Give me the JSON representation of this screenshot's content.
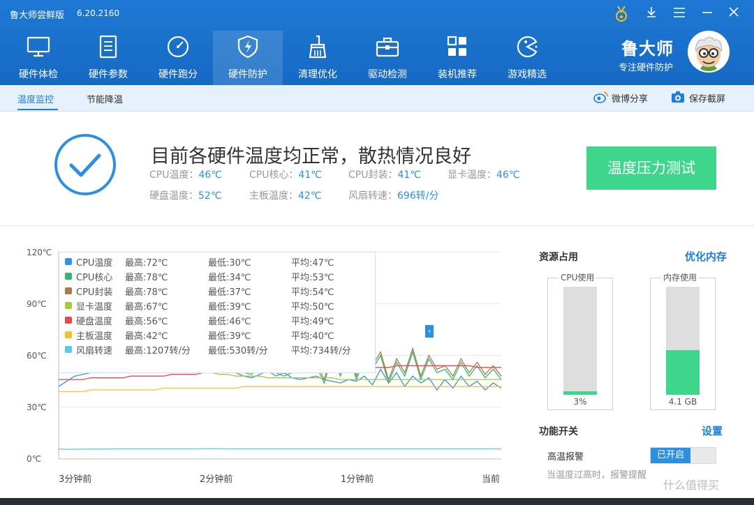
{
  "window": {
    "title": "鲁大师尝鲜版",
    "version": "6.20.2160",
    "controls": [
      "medal-icon",
      "download-icon",
      "menu-icon",
      "minimize-icon",
      "close-icon"
    ]
  },
  "nav": [
    {
      "label": "硬件体检",
      "icon": "monitor-icon"
    },
    {
      "label": "硬件参数",
      "icon": "document-icon"
    },
    {
      "label": "硬件跑分",
      "icon": "speedometer-icon"
    },
    {
      "label": "硬件防护",
      "icon": "shield-icon",
      "active": true
    },
    {
      "label": "清理优化",
      "icon": "broom-icon"
    },
    {
      "label": "驱动检测",
      "icon": "toolbox-icon"
    },
    {
      "label": "装机推荐",
      "icon": "grid-icon"
    },
    {
      "label": "游戏精选",
      "icon": "game-icon"
    }
  ],
  "brand": {
    "name": "鲁大师",
    "slogan": "专注硬件防护"
  },
  "subtabs": [
    {
      "label": "温度监控",
      "active": true
    },
    {
      "label": "节能降温"
    }
  ],
  "subactions": [
    {
      "label": "微博分享",
      "icon": "weibo-icon"
    },
    {
      "label": "保存截屏",
      "icon": "camera-icon"
    }
  ],
  "status": {
    "title": "目前各硬件温度均正常，散热情况良好",
    "readings": [
      {
        "label": "CPU温度：",
        "value": "46℃"
      },
      {
        "label": "CPU核心：",
        "value": "41℃"
      },
      {
        "label": "CPU封装：",
        "value": "41℃"
      },
      {
        "label": "显卡温度：",
        "value": "46℃"
      },
      {
        "label": "硬盘温度：",
        "value": "52℃"
      },
      {
        "label": "主板温度：",
        "value": "42℃"
      },
      {
        "label": "风扇转速：",
        "value": "696转/分"
      }
    ],
    "button": "温度压力测试"
  },
  "chart_data": {
    "type": "line",
    "y_ticks": [
      "120℃",
      "90℃",
      "60℃",
      "30℃",
      "0℃"
    ],
    "ylim": [
      0,
      120
    ],
    "x_ticks": [
      "3分钟前",
      "2分钟前",
      "1分钟前",
      "当前"
    ],
    "legend_placement": "top-left",
    "series": [
      {
        "name": "CPU温度",
        "color": "#3a8ee6",
        "max": "最高:72℃",
        "min": "最低:30℃",
        "avg": "平均:47℃",
        "values": [
          42,
          45,
          48,
          49,
          50,
          50,
          51,
          50,
          52,
          51,
          50,
          52,
          51,
          52,
          51,
          52,
          52,
          51,
          58,
          55,
          52,
          56,
          50,
          48,
          47,
          49,
          51,
          48,
          50,
          47,
          46,
          47,
          48,
          46,
          45,
          44,
          46,
          45,
          48,
          43,
          52,
          44,
          50,
          42,
          48,
          44,
          47,
          40,
          46,
          41,
          48,
          42,
          45,
          40,
          44,
          41
        ]
      },
      {
        "name": "CPU核心",
        "color": "#2fb96e",
        "max": "最高:78℃",
        "min": "最低:34℃",
        "avg": "平均:53℃",
        "values": [
          60,
          61,
          56,
          55,
          55,
          54,
          54,
          53,
          53,
          52,
          52,
          52,
          52,
          53,
          52,
          52,
          53,
          53,
          60,
          58,
          56,
          60,
          52,
          50,
          49,
          55,
          58,
          50,
          48,
          50,
          52,
          60,
          54,
          44,
          60,
          48,
          62,
          46,
          58,
          52,
          60,
          44,
          56,
          48,
          62,
          46,
          58,
          50,
          52,
          46,
          56,
          48,
          54,
          47,
          52,
          46
        ]
      },
      {
        "name": "CPU封装",
        "color": "#b07850",
        "max": "最高:78℃",
        "min": "最低:37℃",
        "avg": "平均:54℃",
        "values": [
          64,
          66,
          62,
          58,
          56,
          56,
          55,
          55,
          54,
          54,
          53,
          53,
          53,
          54,
          53,
          54,
          54,
          55,
          62,
          58,
          56,
          64,
          50,
          52,
          51,
          58,
          60,
          54,
          50,
          52,
          54,
          64,
          56,
          46,
          62,
          50,
          64,
          48,
          60,
          54,
          62,
          46,
          58,
          50,
          64,
          48,
          60,
          52,
          54,
          48,
          58,
          50,
          56,
          49,
          54,
          48
        ]
      },
      {
        "name": "显卡温度",
        "color": "#a8c83a",
        "max": "最高:67℃",
        "min": "最低:39℃",
        "avg": "平均:50℃",
        "values": [
          58,
          57,
          56,
          55,
          55,
          54,
          54,
          53,
          53,
          52,
          52,
          52,
          51,
          51,
          51,
          50,
          50,
          50,
          50,
          50,
          49,
          49,
          48,
          48,
          48,
          48,
          47,
          47,
          47,
          47,
          47,
          47,
          47,
          47,
          47,
          46,
          46,
          46,
          46,
          46,
          46,
          46,
          46,
          46,
          46,
          46,
          46,
          46,
          46,
          46,
          46,
          46,
          46,
          46,
          46,
          46
        ]
      },
      {
        "name": "硬盘温度",
        "color": "#e84a4a",
        "max": "最高:56℃",
        "min": "最低:46℃",
        "avg": "平均:49℃",
        "values": [
          46,
          46,
          46,
          46,
          47,
          47,
          47,
          47,
          47,
          48,
          48,
          48,
          48,
          48,
          49,
          49,
          49,
          49,
          50,
          50,
          50,
          50,
          50,
          51,
          51,
          51,
          51,
          51,
          51,
          52,
          52,
          52,
          52,
          52,
          52,
          52,
          53,
          53,
          53,
          53,
          53,
          53,
          54,
          54,
          54,
          54,
          54,
          54,
          54,
          54,
          54,
          54,
          53,
          53,
          53,
          53
        ]
      },
      {
        "name": "主板温度",
        "color": "#f0c030",
        "max": "最高:42℃",
        "min": "最低:39℃",
        "avg": "平均:40℃",
        "values": [
          39,
          39,
          39,
          39,
          40,
          40,
          40,
          40,
          40,
          40,
          40,
          40,
          40,
          41,
          41,
          41,
          41,
          41,
          41,
          41,
          41,
          41,
          41,
          42,
          42,
          42,
          42,
          42,
          42,
          42,
          42,
          42,
          42,
          42,
          42,
          42,
          42,
          42,
          42,
          42,
          42,
          42,
          42,
          42,
          42,
          42,
          42,
          42,
          42,
          42,
          42,
          42,
          42,
          42,
          42,
          42
        ]
      },
      {
        "name": "风扇转速",
        "color": "#5bc8e8",
        "max": "最高:1207转/分",
        "min": "最低:530转/分",
        "avg": "平均:734转/分",
        "values": [
          5.8,
          5.6,
          5.6,
          5.7,
          5.7,
          5.7,
          5.7,
          5.8,
          5.8,
          5.8,
          5.8,
          5.8,
          5.8,
          5.8,
          5.8,
          5.8,
          5.8,
          5.8,
          5.9,
          5.9,
          5.9,
          5.8,
          5.8,
          5.8,
          5.8,
          5.8,
          5.8,
          5.8,
          5.8,
          5.8,
          5.8,
          5.8,
          5.8,
          5.8,
          5.8,
          5.8,
          5.8,
          5.8,
          5.8,
          5.8,
          5.8,
          5.8,
          5.8,
          5.8,
          5.8,
          5.8,
          5.8,
          5.8,
          5.8,
          5.8,
          5.8,
          5.8,
          5.8,
          5.8,
          5.8,
          5.8
        ]
      }
    ]
  },
  "resources": {
    "title": "资源占用",
    "link": "优化内存",
    "cpu": {
      "caption": "CPU使用",
      "value": "3%",
      "percent": 3
    },
    "mem": {
      "caption": "内存使用",
      "value": "4.1 GB",
      "percent": 41
    }
  },
  "features": {
    "title": "功能开关",
    "link": "设置",
    "alarm_label": "高温报警",
    "alarm_state": "已开启",
    "hint": "当温度过高时，报警提醒"
  },
  "watermark": "什么值得买"
}
